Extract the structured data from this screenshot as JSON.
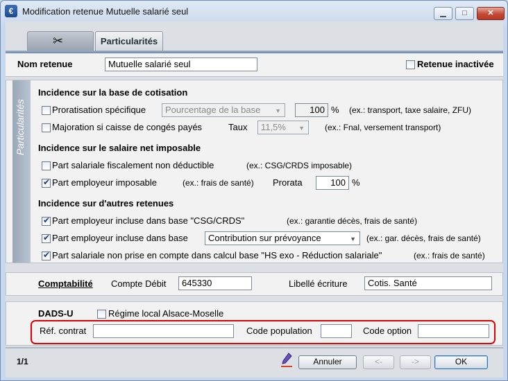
{
  "window": {
    "title": "Modification retenue Mutuelle salarié seul",
    "app_icon_letter": "€"
  },
  "tabs": [
    {
      "label": "",
      "icon": "scissors-fan-icon"
    },
    {
      "label": "Particularités"
    }
  ],
  "header": {
    "name_label": "Nom retenue",
    "name_value": "Mutuelle salarié seul",
    "inactive_label": "Retenue inactivée",
    "inactive_checked": false
  },
  "sidebar_label": "Particularités",
  "base_cotisation": {
    "title": "Incidence sur la base de cotisation",
    "proratisation_label": "Proratisation spécifique",
    "proratisation_checked": false,
    "proratisation_select": "Pourcentage de la base",
    "proratisation_percent": "100",
    "percent_sign": "%",
    "proratisation_hint": "(ex.: transport, taxe salaire, ZFU)",
    "majoration_label": "Majoration si caisse de congés payés",
    "majoration_checked": false,
    "taux_label": "Taux",
    "taux_select": "11,5%",
    "majoration_hint": "(ex.: Fnal, versement transport)"
  },
  "salaire_net": {
    "title": "Incidence sur le salaire net imposable",
    "non_deductible_label": "Part salariale fiscalement non déductible",
    "non_deductible_checked": false,
    "non_deductible_hint": "(ex.: CSG/CRDS imposable)",
    "employeur_imposable_label": "Part employeur imposable",
    "employeur_imposable_checked": true,
    "employeur_imposable_hint": "(ex.: frais de santé)",
    "prorata_label": "Prorata",
    "prorata_value": "100",
    "percent_sign": "%"
  },
  "autres_retenues": {
    "title": "Incidence sur d'autres retenues",
    "csg_label": "Part employeur incluse dans base \"CSG/CRDS\"",
    "csg_checked": true,
    "csg_hint": "(ex.: garantie décès, frais de santé)",
    "base_label": "Part employeur incluse dans base",
    "base_checked": true,
    "base_select": "Contribution sur prévoyance",
    "base_hint": "(ex.: gar. décès, frais de santé)",
    "hs_label": "Part salariale non prise en compte dans calcul base \"HS exo - Réduction salariale\"",
    "hs_checked": true,
    "hs_hint": "(ex.: frais de santé)"
  },
  "comptabilite": {
    "title": "Comptabilité",
    "compte_label": "Compte Débit",
    "compte_value": "645330",
    "libelle_label": "Libellé écriture",
    "libelle_value": "Cotis. Santé"
  },
  "dads": {
    "title": "DADS-U",
    "regime_label": "Régime local Alsace-Moselle",
    "regime_checked": false,
    "ref_contrat_label": "Réf. contrat",
    "ref_contrat_value": "",
    "code_population_label": "Code population",
    "code_population_value": "",
    "code_option_label": "Code option",
    "code_option_value": ""
  },
  "footer": {
    "page_indicator": "1/1",
    "cancel_label": "Annuler",
    "prev_label": "<-",
    "next_label": "->",
    "ok_label": "OK"
  },
  "colors": {
    "highlight": "#e00000",
    "accent": "#3a6fb0"
  }
}
